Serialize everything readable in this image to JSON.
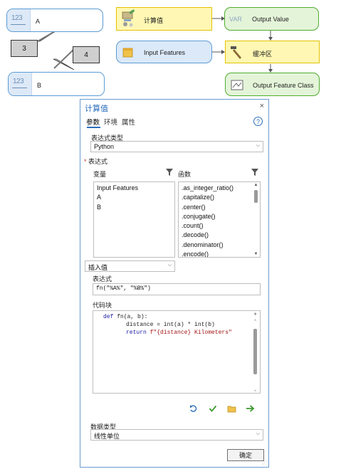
{
  "diagram": {
    "var_a": {
      "icon": "123",
      "label": "A",
      "callout": "3"
    },
    "var_b": {
      "icon": "123",
      "label": "B",
      "callout": "4"
    },
    "calc_tool": {
      "label": "计算值"
    },
    "output_value": {
      "icon_text": "VAR",
      "label": "Output Value"
    },
    "input_features": {
      "label": "Input Features"
    },
    "buffer_tool": {
      "label": "缓冲区"
    },
    "output_feature_class": {
      "label": "Output Feature Class"
    }
  },
  "dialog": {
    "title": "计算值",
    "close": "×",
    "tabs": [
      "参数",
      "环境",
      "属性"
    ],
    "help": "?",
    "expr_type_label": "表达式类型",
    "expr_type_value": "Python",
    "expression_section": "表达式",
    "required_mark": "*",
    "variables_label": "变量",
    "variables": [
      "Input Features",
      "A",
      "B"
    ],
    "functions_label": "函数",
    "functions": [
      ".as_integer_ratio()",
      ".capitalize()",
      ".center()",
      ".conjugate()",
      ".count()",
      ".decode()",
      ".denominator()",
      ".encode()"
    ],
    "insert_value": "插入值",
    "expression_label": "表达式",
    "expression_value": "fn(\"%A%\", \"%B%\")",
    "code_block_label": "代码块",
    "code_block": {
      "line1_kw": "def",
      "line1_rest": " fn(a, b):",
      "line2": "distance = int(a) * int(b)",
      "line3_kw": "return",
      "line3_rest": " f\"{distance} Kilometers\""
    },
    "data_type_label": "数据类型",
    "data_type_value": "线性单位",
    "ok_button": "确定"
  },
  "colors": {
    "accent": "#2a6ebb",
    "tool_fill": "#fff7b3",
    "data_fill": "#dbe9f8",
    "output_fill": "#e4f4d9",
    "code_keyword": "#1a1aa6",
    "code_string": "#a31515"
  }
}
